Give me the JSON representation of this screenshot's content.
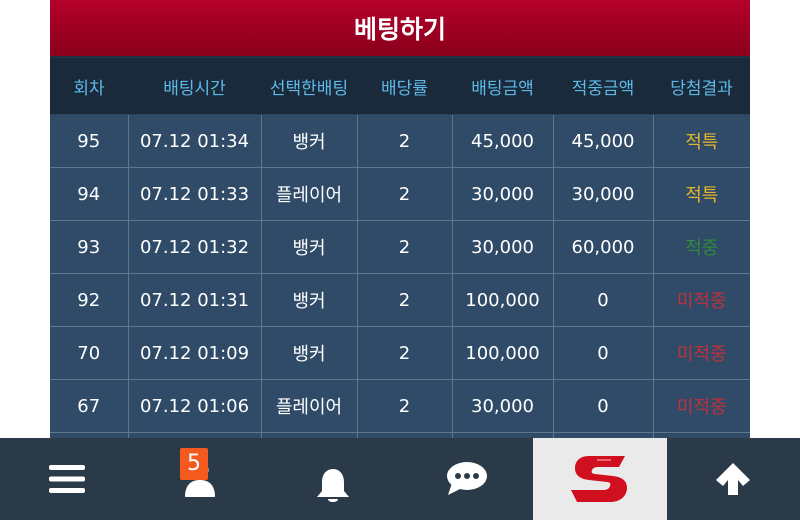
{
  "header": {
    "title": "베팅하기"
  },
  "table": {
    "columns": [
      "회차",
      "배팅시간",
      "선택한배팅",
      "배당률",
      "배팅금액",
      "적중금액",
      "당첨결과"
    ],
    "rows": [
      {
        "round": "95",
        "time": "07.12 01:34",
        "choice": "뱅커",
        "odds": "2",
        "bet": "45,000",
        "payout": "45,000",
        "result": "적특",
        "result_type": "special"
      },
      {
        "round": "94",
        "time": "07.12 01:33",
        "choice": "플레이어",
        "odds": "2",
        "bet": "30,000",
        "payout": "30,000",
        "result": "적특",
        "result_type": "special"
      },
      {
        "round": "93",
        "time": "07.12 01:32",
        "choice": "뱅커",
        "odds": "2",
        "bet": "30,000",
        "payout": "60,000",
        "result": "적중",
        "result_type": "hit"
      },
      {
        "round": "92",
        "time": "07.12 01:31",
        "choice": "뱅커",
        "odds": "2",
        "bet": "100,000",
        "payout": "0",
        "result": "미적중",
        "result_type": "miss"
      },
      {
        "round": "70",
        "time": "07.12 01:09",
        "choice": "뱅커",
        "odds": "2",
        "bet": "100,000",
        "payout": "0",
        "result": "미적중",
        "result_type": "miss"
      },
      {
        "round": "67",
        "time": "07.12 01:06",
        "choice": "플레이어",
        "odds": "2",
        "bet": "30,000",
        "payout": "0",
        "result": "미적중",
        "result_type": "miss"
      }
    ]
  },
  "nav": {
    "items": [
      {
        "name": "menu",
        "icon": "hamburger-icon"
      },
      {
        "name": "profile",
        "icon": "user-icon"
      },
      {
        "name": "notifications",
        "icon": "bell-icon"
      },
      {
        "name": "chat",
        "icon": "chat-bubble-icon"
      },
      {
        "name": "logo",
        "icon": "s-logo-icon"
      },
      {
        "name": "scroll-top",
        "icon": "arrow-up-icon"
      }
    ],
    "notification_count": "5"
  },
  "colors": {
    "header_red": "#a00024",
    "table_header_bg": "#1b2a3b",
    "table_header_text": "#5cb9ea",
    "row_bg": "#2f4b68",
    "result_special": "#e7b52c",
    "result_hit": "#2f8a3a",
    "result_miss": "#c0303a",
    "nav_bg": "#2b3a48",
    "badge": "#f45a1e",
    "logo_red": "#d0101e"
  }
}
